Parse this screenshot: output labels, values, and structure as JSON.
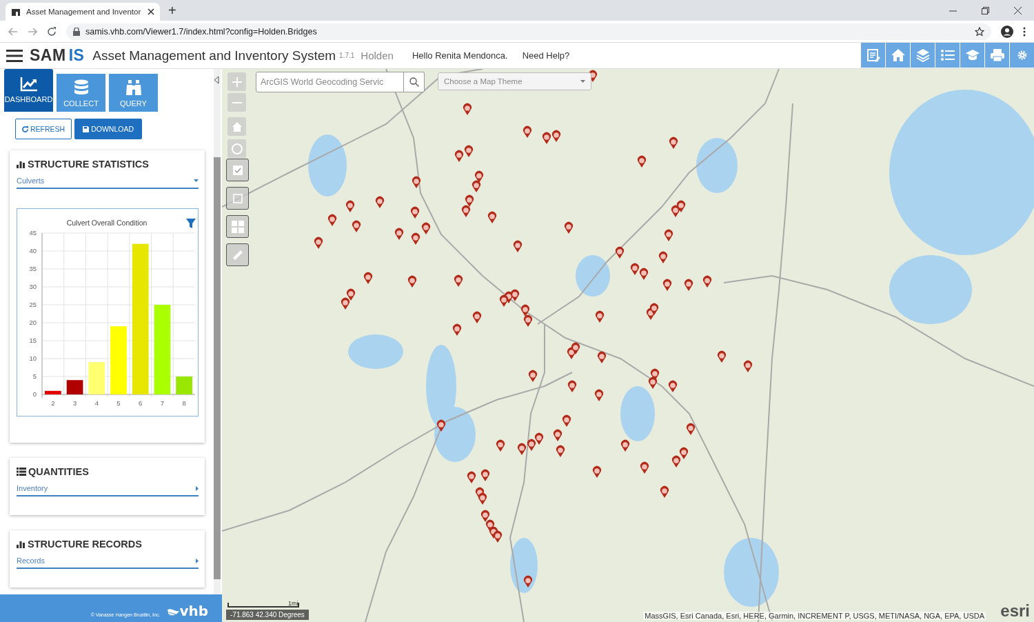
{
  "browser": {
    "tab_title": "Asset Management and Inventor",
    "new_tab": "+",
    "url": "samis.vhb.com/Viewer1.7/index.html?config=Holden.Bridges"
  },
  "header": {
    "logo_left": "SAM",
    "logo_right": "IS",
    "title": "Asset Management and Inventory System",
    "version": "1.7.1",
    "town": "Holden",
    "greeting": "Hello Renita Mendonca.",
    "help": "Need Help?"
  },
  "nav_tabs": [
    {
      "label": "DASHBOARD",
      "selected": true
    },
    {
      "label": "COLLECT",
      "selected": false
    },
    {
      "label": "QUERY",
      "selected": false
    }
  ],
  "actions": {
    "refresh": "REFRESH",
    "download": "DOWNLOAD"
  },
  "statistics": {
    "title": "STRUCTURE STATISTICS",
    "dropdown": "Culverts",
    "chart_data": {
      "type": "bar",
      "title": "Culvert Overall Condition",
      "stacked": true,
      "grid": true,
      "series": [
        {
          "name": "2",
          "color": "#e00000",
          "values": [
            1,
            null,
            null,
            null,
            null,
            null,
            null
          ]
        },
        {
          "name": "3",
          "color": "#b00000",
          "values": [
            null,
            4,
            null,
            null,
            null,
            null,
            null
          ]
        },
        {
          "name": "4",
          "color": "#ffff70",
          "values": [
            null,
            null,
            9,
            null,
            null,
            null,
            null
          ]
        },
        {
          "name": "5",
          "color": "#ffff00",
          "values": [
            null,
            null,
            null,
            19,
            null,
            null,
            null
          ]
        },
        {
          "name": "6",
          "color": "#e6e600",
          "values": [
            null,
            null,
            null,
            null,
            42,
            null,
            null
          ]
        },
        {
          "name": "7",
          "color": "#aaff00",
          "values": [
            null,
            null,
            null,
            null,
            null,
            25,
            null
          ]
        },
        {
          "name": "8",
          "color": "#99e600",
          "values": [
            null,
            null,
            null,
            null,
            null,
            null,
            5
          ]
        }
      ],
      "ylim": [
        0,
        45
      ],
      "yticks": [
        0,
        5,
        10,
        15,
        20,
        25,
        30,
        35,
        40,
        45
      ]
    }
  },
  "quantities": {
    "title": "QUANTITIES",
    "dropdown": "Inventory"
  },
  "records": {
    "title": "STRUCTURE RECORDS",
    "dropdown": "Records"
  },
  "footer": {
    "copyright": "© Vanasse Hangen Brustlin, Inc.",
    "logo": "vhb"
  },
  "map": {
    "search_placeholder": "ArcGIS World Geocoding Servic",
    "theme_placeholder": "Choose a Map Theme",
    "scale_label": "1mi",
    "coordinates": "-71.863 42.340 Degrees",
    "attribution": "MassGIS, Esri Canada, Esri, HERE, Garmin, INCREMENT P, USGS, METI/NASA, NGA, EPA, USDA",
    "esri_logo": "esri"
  }
}
